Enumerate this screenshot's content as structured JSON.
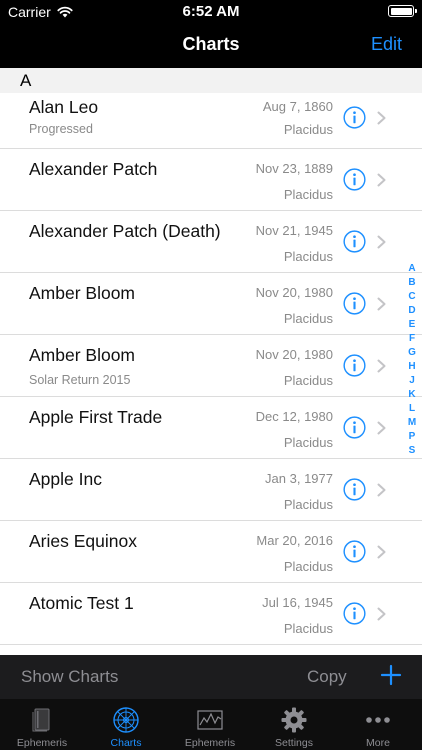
{
  "status_bar": {
    "carrier": "Carrier",
    "time": "6:52 AM"
  },
  "nav": {
    "title": "Charts",
    "edit_label": "Edit"
  },
  "section_header": "A",
  "charts": [
    {
      "name": "Alan Leo",
      "subtitle": "Progressed",
      "date": "Aug 7, 1860",
      "system": "Placidus"
    },
    {
      "name": "Alexander Patch",
      "subtitle": "",
      "date": "Nov 23, 1889",
      "system": "Placidus"
    },
    {
      "name": "Alexander Patch (Death)",
      "subtitle": "",
      "date": "Nov 21, 1945",
      "system": "Placidus"
    },
    {
      "name": "Amber Bloom",
      "subtitle": "",
      "date": "Nov 20, 1980",
      "system": "Placidus"
    },
    {
      "name": "Amber Bloom",
      "subtitle": "Solar Return 2015",
      "date": "Nov 20, 1980",
      "system": "Placidus"
    },
    {
      "name": "Apple First Trade",
      "subtitle": "",
      "date": "Dec 12, 1980",
      "system": "Placidus"
    },
    {
      "name": "Apple Inc",
      "subtitle": "",
      "date": "Jan 3, 1977",
      "system": "Placidus"
    },
    {
      "name": "Aries Equinox",
      "subtitle": "",
      "date": "Mar 20, 2016",
      "system": "Placidus"
    },
    {
      "name": "Atomic Test 1",
      "subtitle": "",
      "date": "Jul 16, 1945",
      "system": "Placidus"
    }
  ],
  "index_letters": [
    "A",
    "B",
    "C",
    "D",
    "E",
    "F",
    "G",
    "H",
    "J",
    "K",
    "L",
    "M",
    "P",
    "S"
  ],
  "toolbar": {
    "show_label": "Show Charts",
    "copy_label": "Copy"
  },
  "tabs": [
    {
      "label": "Ephemeris",
      "icon": "book-icon"
    },
    {
      "label": "Charts",
      "icon": "wheel-icon",
      "active": true
    },
    {
      "label": "Ephemeris",
      "icon": "graph-icon"
    },
    {
      "label": "Settings",
      "icon": "gear-icon"
    },
    {
      "label": "More",
      "icon": "more-icon"
    }
  ],
  "colors": {
    "accent": "#1e90ff",
    "toolbar_bg": "#1c1c1e",
    "topbar_bg": "#000000"
  }
}
